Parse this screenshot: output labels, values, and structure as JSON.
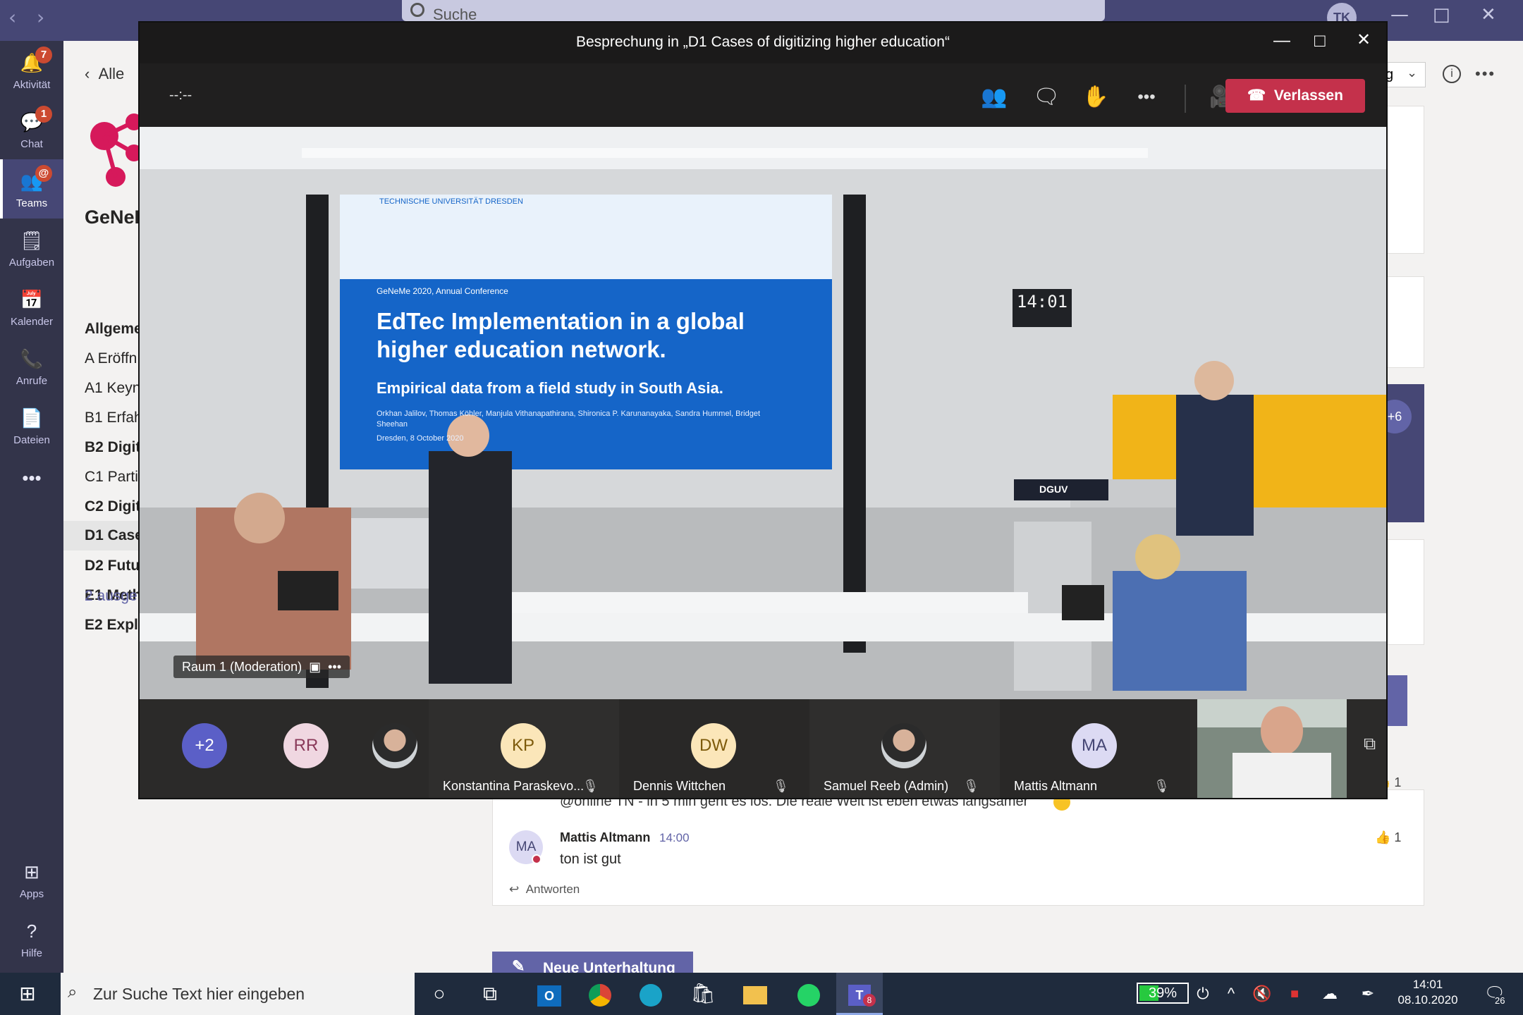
{
  "titlebar": {
    "search_placeholder": "Suche",
    "avatar_initials": "TK",
    "nav_back": "‹",
    "nav_forward": "›",
    "win_min": "—",
    "win_max": "□",
    "win_close": "✕"
  },
  "rail": {
    "items": [
      {
        "label": "Aktivität",
        "icon": "bell-icon",
        "glyph": "🔔",
        "badge": "7"
      },
      {
        "label": "Chat",
        "icon": "chat-icon",
        "glyph": "💬",
        "badge": "1"
      },
      {
        "label": "Teams",
        "icon": "teams-icon",
        "glyph": "👥",
        "badge": "@",
        "active": true
      },
      {
        "label": "Aufgaben",
        "icon": "tasks-icon",
        "glyph": "🗒",
        "badge": ""
      },
      {
        "label": "Kalender",
        "icon": "calendar-icon",
        "glyph": "📅",
        "badge": ""
      },
      {
        "label": "Anrufe",
        "icon": "phone-icon",
        "glyph": "📞",
        "badge": ""
      },
      {
        "label": "Dateien",
        "icon": "files-icon",
        "glyph": "📄",
        "badge": ""
      }
    ],
    "more": "•••",
    "apps": "Apps",
    "help": "Hilfe"
  },
  "team_panel": {
    "back_label": "Alle",
    "title": "GeNeI",
    "channels": [
      {
        "label": "Allgeme",
        "bold": true
      },
      {
        "label": "A Eröffn",
        "bold": false
      },
      {
        "label": "A1 Keyn",
        "bold": false
      },
      {
        "label": "B1 Erfah",
        "bold": false
      },
      {
        "label": "B2 Digit",
        "bold": true
      },
      {
        "label": "C1 Partiz",
        "bold": false
      },
      {
        "label": "C2 Digit",
        "bold": true
      },
      {
        "label": "D1 Case",
        "bold": true,
        "selected": true
      },
      {
        "label": "D2 Futu",
        "bold": true
      },
      {
        "label": "E1 Meth",
        "bold": true
      },
      {
        "label": "E2 Explo",
        "bold": true
      }
    ],
    "hidden_link": "2 ausge"
  },
  "background_ui": {
    "dropdown_partial": "g",
    "plus_count": "+6"
  },
  "meeting": {
    "title": "Besprechung in „D1 Cases of digitizing higher education“",
    "timer": "--:--",
    "leave_label": "Verlassen",
    "room_label": "Raum 1 (Moderation)",
    "slide": {
      "university": "TECHNISCHE UNIVERSITÄT DRESDEN",
      "conference": "GeNeMe 2020, Annual Conference",
      "heading": "EdTec Implementation in a global higher education network.",
      "subheading": "Empirical data from a field study in South Asia.",
      "authors": "Orkhan Jalilov, Thomas Köhler, Manjula Vithanapathirana, Shironica P. Karunanayaka, Sandra Hummel, Bridget Sheehan",
      "place": "Dresden, 8 October 2020"
    },
    "room_clock": "14:01",
    "podium_brand": "DGUV",
    "participants": [
      {
        "initials": "+2",
        "name": "",
        "color": "#5b5fc7",
        "text": "#fff"
      },
      {
        "initials": "RR",
        "name": "",
        "color": "#f0d7e1",
        "text": "#8a3a5a"
      },
      {
        "initials": "",
        "name": "",
        "photo": true
      },
      {
        "initials": "KP",
        "name": "Konstantina Paraskevo...",
        "color": "#fbe6b9",
        "text": "#7d5a0b"
      },
      {
        "initials": "DW",
        "name": "Dennis Wittchen",
        "color": "#fbe6b9",
        "text": "#7d5a0b"
      },
      {
        "initials": "",
        "name": "Samuel Reeb (Admin)",
        "photo": true
      },
      {
        "initials": "MA",
        "name": "Mattis Altmann",
        "color": "#dcdaf3",
        "text": "#464775"
      }
    ]
  },
  "chat": {
    "partial_message": "@online TN - in 5 min geht es los. Die reale Welt ist eben etwas langsamer",
    "partial_reaction": "1",
    "message": {
      "avatar": "MA",
      "author": "Mattis Altmann",
      "time": "14:00",
      "text": "ton ist gut",
      "reaction_count": "1"
    },
    "reply_label": "Antworten",
    "new_conversation": "Neue Unterhaltung"
  },
  "taskbar": {
    "search_placeholder": "Zur Suche Text hier eingeben",
    "battery": "39%",
    "battery_level": 0.39,
    "time": "14:01",
    "date": "08.10.2020",
    "teams_badge": "8",
    "notification_count": "26"
  }
}
